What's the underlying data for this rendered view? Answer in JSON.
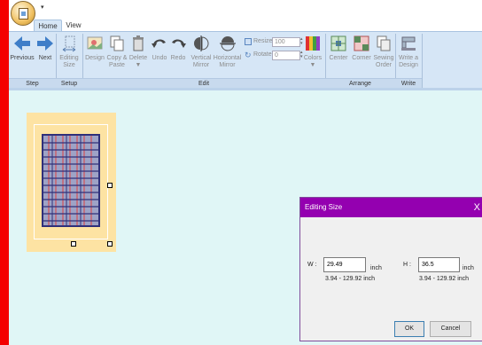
{
  "app": {
    "quick_access_arrow": "▾"
  },
  "tabs": [
    {
      "label": "Home"
    },
    {
      "label": "View"
    }
  ],
  "ribbon": {
    "groups": {
      "step": "Step",
      "setup": "Setup",
      "edit": "Edit",
      "arrange": "Arrange",
      "write": "Write"
    },
    "buttons": {
      "previous": "Previous",
      "next": "Next",
      "editing_size_1": "Editing",
      "editing_size_2": "Size",
      "design": "Design",
      "copy_paste_1": "Copy &",
      "copy_paste_2": "Paste",
      "delete": "Delete",
      "delete_arrow": "▼",
      "undo": "Undo",
      "redo": "Redo",
      "vmirror_1": "Vertical",
      "vmirror_2": "Mirror",
      "hmirror_1": "Horizontal",
      "hmirror_2": "Mirror",
      "resize_label": "Resize",
      "resize_value": "100",
      "rotate_label": "Rotate",
      "rotate_value": "0",
      "colors": "Colors",
      "colors_arrow": "▼",
      "center": "Center",
      "corner": "Corner",
      "sewing_order_1": "Sewing",
      "sewing_order_2": "Order",
      "write_design_1": "Write a",
      "write_design_2": "Design"
    }
  },
  "dialog": {
    "title": "Editing Size",
    "close": "X",
    "width_label": "W :",
    "width_value": "29.49",
    "width_unit": "inch",
    "width_range": "3.94 - 129.92 inch",
    "height_label": "H :",
    "height_value": "36.5",
    "height_unit": "inch",
    "height_range": "3.94 - 129.92 inch",
    "ok": "OK",
    "cancel": "Cancel"
  },
  "colors": {
    "accent": "#9400b0",
    "ribbon": "#d6e6f6",
    "canvas": "#e0f6f6",
    "hoop": "#fde3a3",
    "grid_blue": "#30307a",
    "grid_red": "#e04040"
  }
}
